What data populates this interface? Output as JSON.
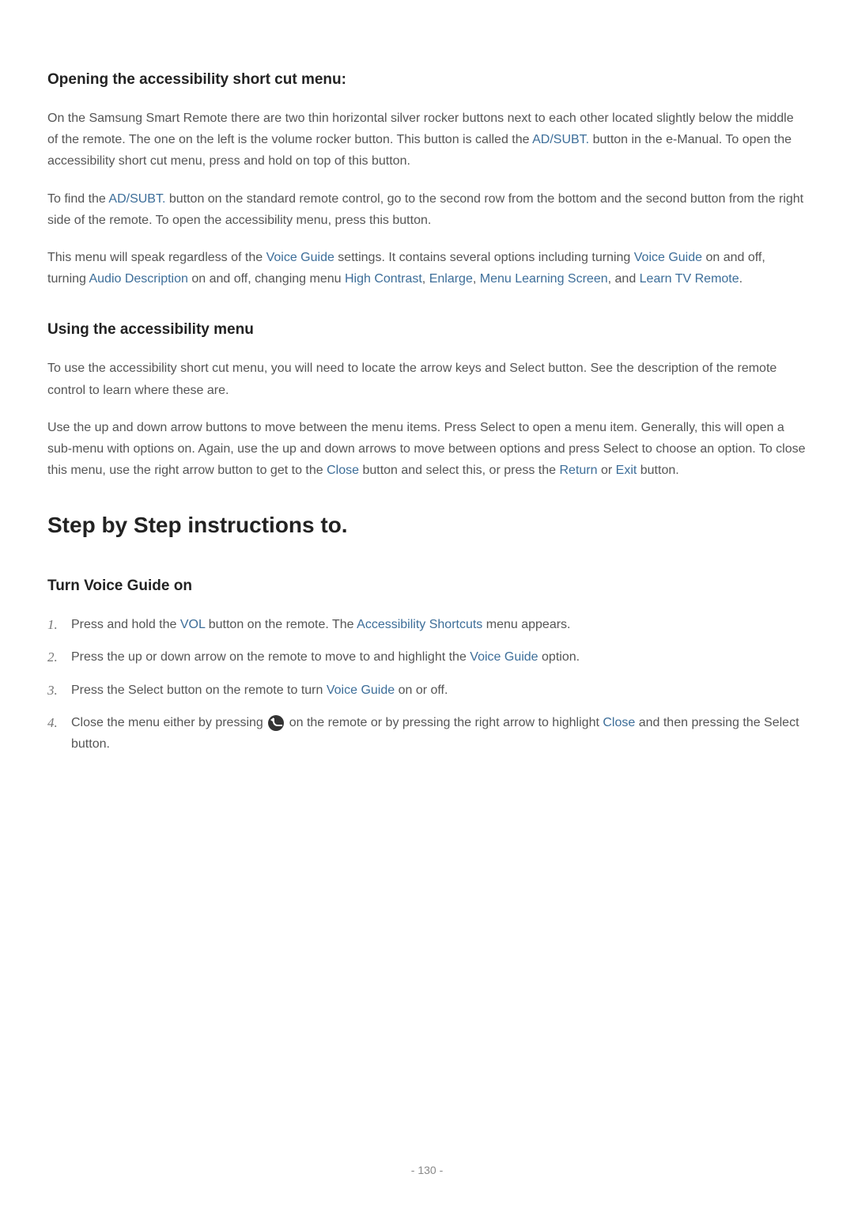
{
  "sections": {
    "opening": {
      "heading": "Opening the accessibility short cut menu:",
      "p1_a": "On the Samsung Smart Remote there are two thin horizontal silver rocker buttons next to each other located slightly below the middle of the remote. The one on the left is the volume rocker button. This button is called the ",
      "p1_term1": "AD/SUBT.",
      "p1_b": " button in the e-Manual. To open the accessibility short cut menu, press and hold on top of this button.",
      "p2_a": "To find the ",
      "p2_term1": "AD/SUBT.",
      "p2_b": " button on the standard remote control, go to the second row from the bottom and the second button from the right side of the remote. To open the accessibility menu, press this button.",
      "p3_a": "This menu will speak regardless of the ",
      "p3_term1": "Voice Guide",
      "p3_b": " settings. It contains several options including turning ",
      "p3_term2": "Voice Guide",
      "p3_c": " on and off, turning ",
      "p3_term3": "Audio Description",
      "p3_d": " on and off, changing menu ",
      "p3_term4": "High Contrast",
      "p3_e": ", ",
      "p3_term5": "Enlarge",
      "p3_f": ", ",
      "p3_term6": "Menu Learning Screen",
      "p3_g": ", and ",
      "p3_term7": "Learn TV Remote",
      "p3_h": "."
    },
    "using": {
      "heading": "Using the accessibility menu",
      "p1": "To use the accessibility short cut menu, you will need to locate the arrow keys and Select button. See the description of the remote control to learn where these are.",
      "p2_a": "Use the up and down arrow buttons to move between the menu items. Press Select to open a menu item. Generally, this will open a sub-menu with options on. Again, use the up and down arrows to move between options and press Select to choose an option. To close this menu, use the right arrow button to get to the ",
      "p2_term1": "Close",
      "p2_b": " button and select this, or press the ",
      "p2_term2": "Return",
      "p2_c": " or ",
      "p2_term3": "Exit",
      "p2_d": " button."
    },
    "stepbystep": {
      "heading": "Step by Step instructions to.",
      "subsection": {
        "heading": "Turn Voice Guide on",
        "item1_a": "Press and hold the ",
        "item1_term1": "VOL",
        "item1_b": " button on the remote. The ",
        "item1_term2": "Accessibility Shortcuts",
        "item1_c": " menu appears.",
        "item2_a": "Press the up or down arrow on the remote to move to and highlight the ",
        "item2_term1": "Voice Guide",
        "item2_b": " option.",
        "item3_a": "Press the Select button on the remote to turn ",
        "item3_term1": "Voice Guide",
        "item3_b": " on or off.",
        "item4_a": "Close the menu either by pressing ",
        "item4_b": " on the remote or by pressing the right arrow to highlight ",
        "item4_term1": "Close",
        "item4_c": " and then pressing the Select button."
      }
    }
  },
  "pageNumber": "- 130 -"
}
